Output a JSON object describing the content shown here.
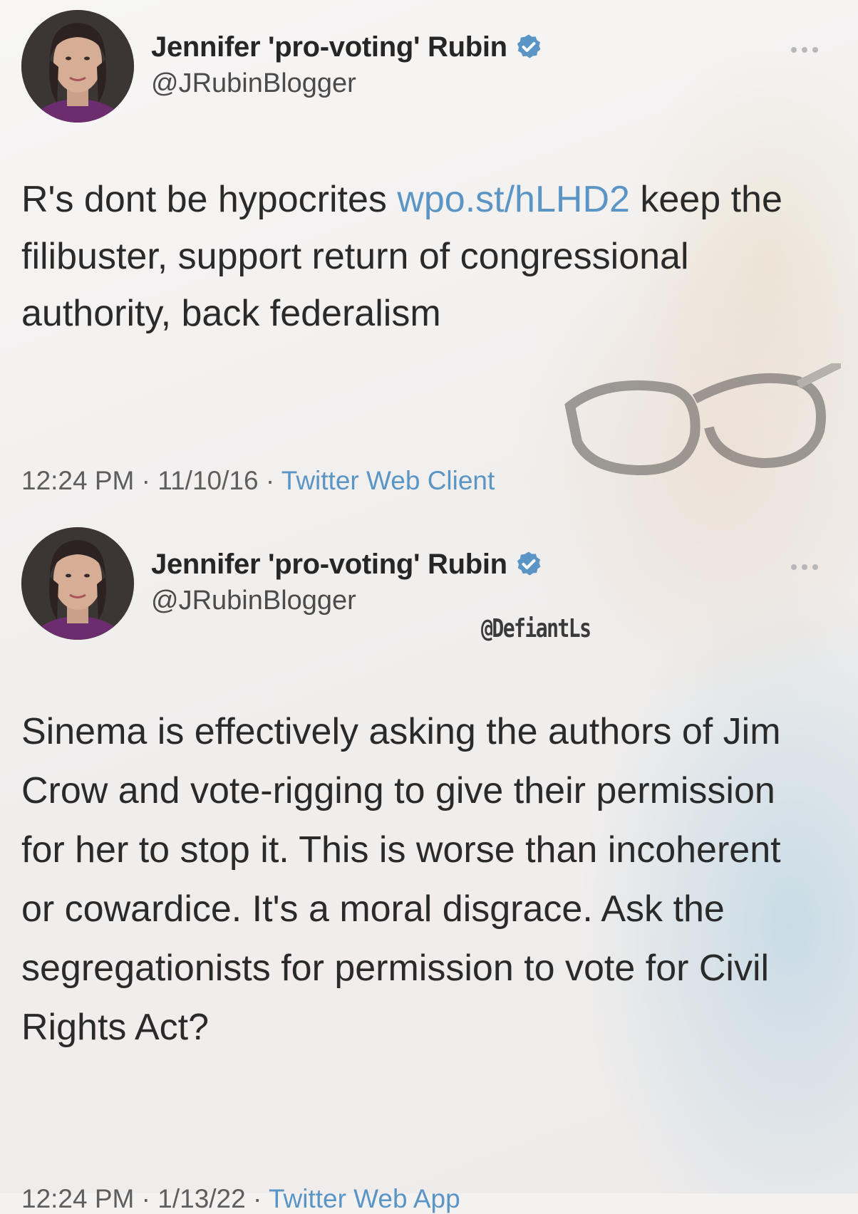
{
  "tweets": [
    {
      "display_name": "Jennifer 'pro-voting' Rubin",
      "handle": "@JRubinBlogger",
      "text_before_link": "R's dont be hypocrites ",
      "link_text": "wpo.st/hLHD2",
      "text_after_link": " keep the filibuster, support return of congressional authority, back federalism",
      "time": "12:24 PM",
      "date": "11/10/16",
      "separator": " · ",
      "source": "Twitter Web Client"
    },
    {
      "display_name": "Jennifer 'pro-voting' Rubin",
      "handle": "@JRubinBlogger",
      "text": "Sinema is effectively asking the authors of Jim Crow and vote-rigging to give their permission for her to stop it. This is worse than incoherent or cowardice. It's a moral disgrace. Ask the segregationists for permission to vote for Civil Rights Act?",
      "time": "12:24 PM",
      "date": "1/13/22",
      "separator": " · ",
      "source": "Twitter Web App"
    }
  ],
  "watermark": "@DefiantLs",
  "icons": {
    "verified": "verified-badge-icon",
    "more": "more-options-icon",
    "avatar": "avatar"
  },
  "colors": {
    "link": "#5b95c6",
    "verified": "#5b95c6",
    "text": "#2a2a2a",
    "meta": "#5e5e5e"
  }
}
